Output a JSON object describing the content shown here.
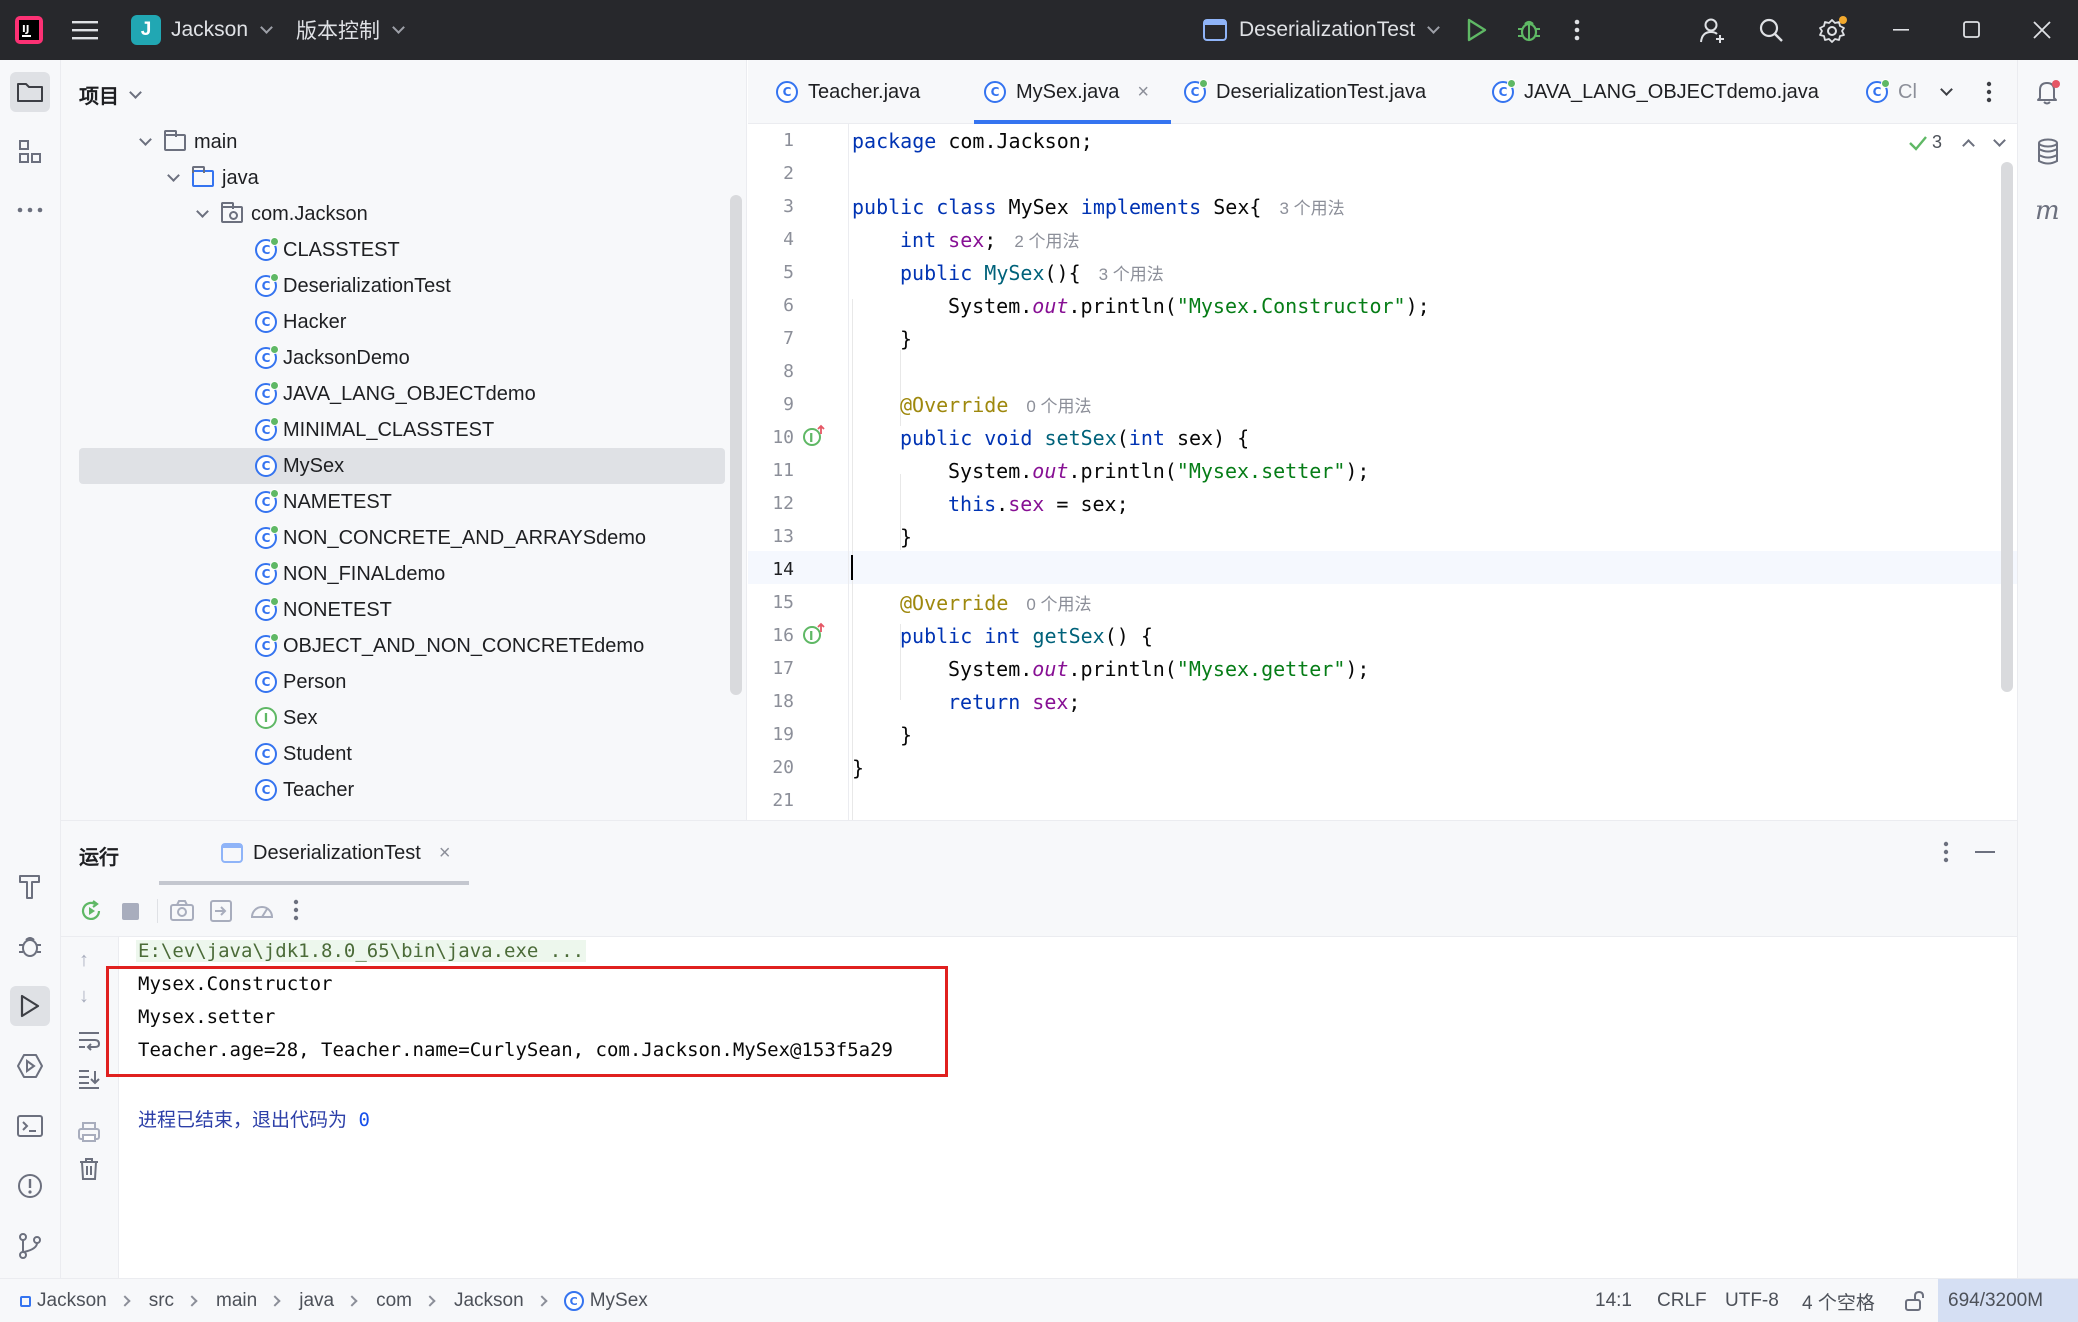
{
  "titlebar": {
    "project_badge": "J",
    "project_name": "Jackson",
    "vcs_label": "版本控制",
    "run_config": "DeserializationTest"
  },
  "project_panel": {
    "title": "项目",
    "tree": [
      {
        "label": "main",
        "kind": "folder"
      },
      {
        "label": "java",
        "kind": "folder"
      },
      {
        "label": "com.Jackson",
        "kind": "package"
      },
      {
        "label": "CLASSTEST",
        "kind": "class-run"
      },
      {
        "label": "DeserializationTest",
        "kind": "class-run"
      },
      {
        "label": "Hacker",
        "kind": "class"
      },
      {
        "label": "JacksonDemo",
        "kind": "class-run"
      },
      {
        "label": "JAVA_LANG_OBJECTdemo",
        "kind": "class-run"
      },
      {
        "label": "MINIMAL_CLASSTEST",
        "kind": "class-run"
      },
      {
        "label": "MySex",
        "kind": "class",
        "selected": true
      },
      {
        "label": "NAMETEST",
        "kind": "class-run"
      },
      {
        "label": "NON_CONCRETE_AND_ARRAYSdemo",
        "kind": "class-run"
      },
      {
        "label": "NON_FINALdemo",
        "kind": "class-run"
      },
      {
        "label": "NONETEST",
        "kind": "class-run"
      },
      {
        "label": "OBJECT_AND_NON_CONCRETEdemo",
        "kind": "class-run"
      },
      {
        "label": "Person",
        "kind": "class"
      },
      {
        "label": "Sex",
        "kind": "interface"
      },
      {
        "label": "Student",
        "kind": "class"
      },
      {
        "label": "Teacher",
        "kind": "class"
      }
    ]
  },
  "editor_tabs": [
    {
      "label": "Teacher.java",
      "active": false
    },
    {
      "label": "MySex.java",
      "active": true
    },
    {
      "label": "DeserializationTest.java",
      "active": false
    },
    {
      "label": "JAVA_LANG_OBJECTdemo.java",
      "active": false
    },
    {
      "label": "Cl",
      "active": false
    }
  ],
  "editor": {
    "inspection_count": "3",
    "current_line": "14",
    "line_numbers": [
      "1",
      "2",
      "3",
      "4",
      "5",
      "6",
      "7",
      "8",
      "9",
      "10",
      "11",
      "12",
      "13",
      "14",
      "15",
      "16",
      "17",
      "18",
      "19",
      "20",
      "21"
    ],
    "hints": {
      "h3": "3 个用法",
      "h4": "2 个用法",
      "h5": "3 个用法",
      "h9": "0 个用法",
      "h15": "0 个用法"
    },
    "code": {
      "l1_kw": "package",
      "l1_rest": " com.Jackson;",
      "l3_kw": "public class",
      "l3_name": " MySex ",
      "l3_kw2": "implements",
      "l3_rest": " Sex{",
      "l4_kw": "int",
      "l4_fld": " sex",
      "l4_rest": ";",
      "l5_kw": "public",
      "l5_meth": " MySex",
      "l5_rest": "(){",
      "l6_a": "System.",
      "l6_out": "out",
      "l6_b": ".println(",
      "l6_str": "\"Mysex.Constructor\"",
      "l6_c": ");",
      "l7": "}",
      "l9_ann": "@Override",
      "l10_kw": "public void",
      "l10_meth": " setSex",
      "l10_a": "(",
      "l10_kw2": "int",
      "l10_b": " sex) {",
      "l11_a": "System.",
      "l11_out": "out",
      "l11_b": ".println(",
      "l11_str": "\"Mysex.setter\"",
      "l11_c": ");",
      "l12_kw": "this",
      "l12_a": ".",
      "l12_fld": "sex",
      "l12_b": " = sex;",
      "l13": "}",
      "l15_ann": "@Override",
      "l16_kw": "public int",
      "l16_meth": " getSex",
      "l16_a": "() {",
      "l17_a": "System.",
      "l17_out": "out",
      "l17_b": ".println(",
      "l17_str": "\"Mysex.getter\"",
      "l17_c": ");",
      "l18_kw": "return",
      "l18_fld": " sex",
      "l18_a": ";",
      "l19": "}",
      "l20": "}"
    }
  },
  "run_panel": {
    "title": "运行",
    "tab_label": "DeserializationTest",
    "console": {
      "cmd": "E:\\ev\\java\\jdk1.8.0_65\\bin\\java.exe ...",
      "out1": "Mysex.Constructor",
      "out2": "Mysex.setter",
      "out3": "Teacher.age=28, Teacher.name=CurlySean, com.Jackson.MySex@153f5a29",
      "exit_prefix": "进程已结束，退出代码为 ",
      "exit_code": "0"
    },
    "highlight_color": "#e0201f"
  },
  "statusbar": {
    "breadcrumbs": [
      "Jackson",
      "src",
      "main",
      "java",
      "com",
      "Jackson",
      "MySex"
    ],
    "position": "14:1",
    "line_sep": "CRLF",
    "encoding": "UTF-8",
    "indent": "4 个空格",
    "memory": "694/3200M"
  },
  "colors": {
    "accent": "#3574f0",
    "keyword": "#0033b3",
    "string": "#067d17",
    "field": "#871094",
    "annotation": "#9e880d"
  }
}
